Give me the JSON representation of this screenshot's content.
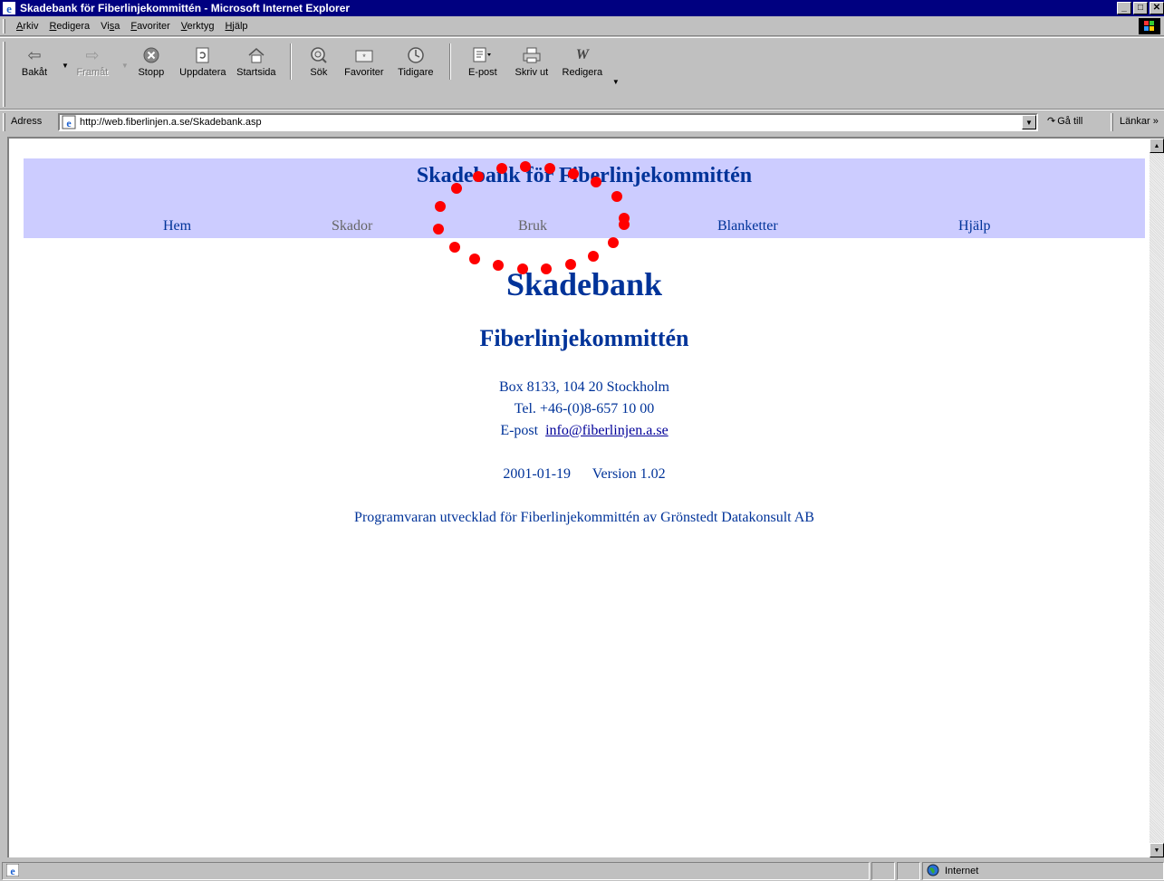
{
  "window": {
    "title": "Skadebank för Fiberlinjekommittén - Microsoft Internet Explorer",
    "minimize": "_",
    "maximize": "□",
    "close": "✕"
  },
  "menu": [
    {
      "key": "A",
      "rest": "rkiv"
    },
    {
      "key": "R",
      "rest": "edigera"
    },
    {
      "pre": "Vi",
      "key": "s",
      "rest": "a"
    },
    {
      "key": "F",
      "rest": "avoriter"
    },
    {
      "key": "V",
      "rest": "erktyg"
    },
    {
      "key": "H",
      "rest": "jälp"
    }
  ],
  "toolbar": {
    "back": "Bakåt",
    "forward": "Framåt",
    "stop": "Stopp",
    "refresh": "Uppdatera",
    "home": "Startsida",
    "search": "Sök",
    "favorites": "Favoriter",
    "history": "Tidigare",
    "mail": "E-post",
    "print": "Skriv ut",
    "edit": "Redigera"
  },
  "address": {
    "label": "Adress",
    "url": "http://web.fiberlinjen.a.se/Skadebank.asp",
    "go": "Gå till",
    "links": "Länkar"
  },
  "page": {
    "banner_title": "Skadebank för Fiberlinjekommittén",
    "nav": [
      "Hem",
      "Skador",
      "Bruk",
      "Blanketter",
      "Hjälp"
    ],
    "main_title": "Skadebank",
    "sub_title": "Fiberlinjekommittén",
    "address_line": "Box 8133, 104 20 Stockholm",
    "phone_line": "Tel. +46-(0)8-657 10 00",
    "email_prefix": "E-post",
    "email": "info@fiberlinjen.a.se",
    "date": "2001-01-19",
    "version": "Version 1.02",
    "credits": "Programvaran utvecklad för Fiberlinjekommittén av Grönstedt Datakonsult AB"
  },
  "status": {
    "zone": "Internet"
  },
  "colors": {
    "banner_bg": "#ccccff",
    "text_blue": "#003399",
    "nav_muted": "#666666",
    "annotation_red": "#ff0000"
  }
}
